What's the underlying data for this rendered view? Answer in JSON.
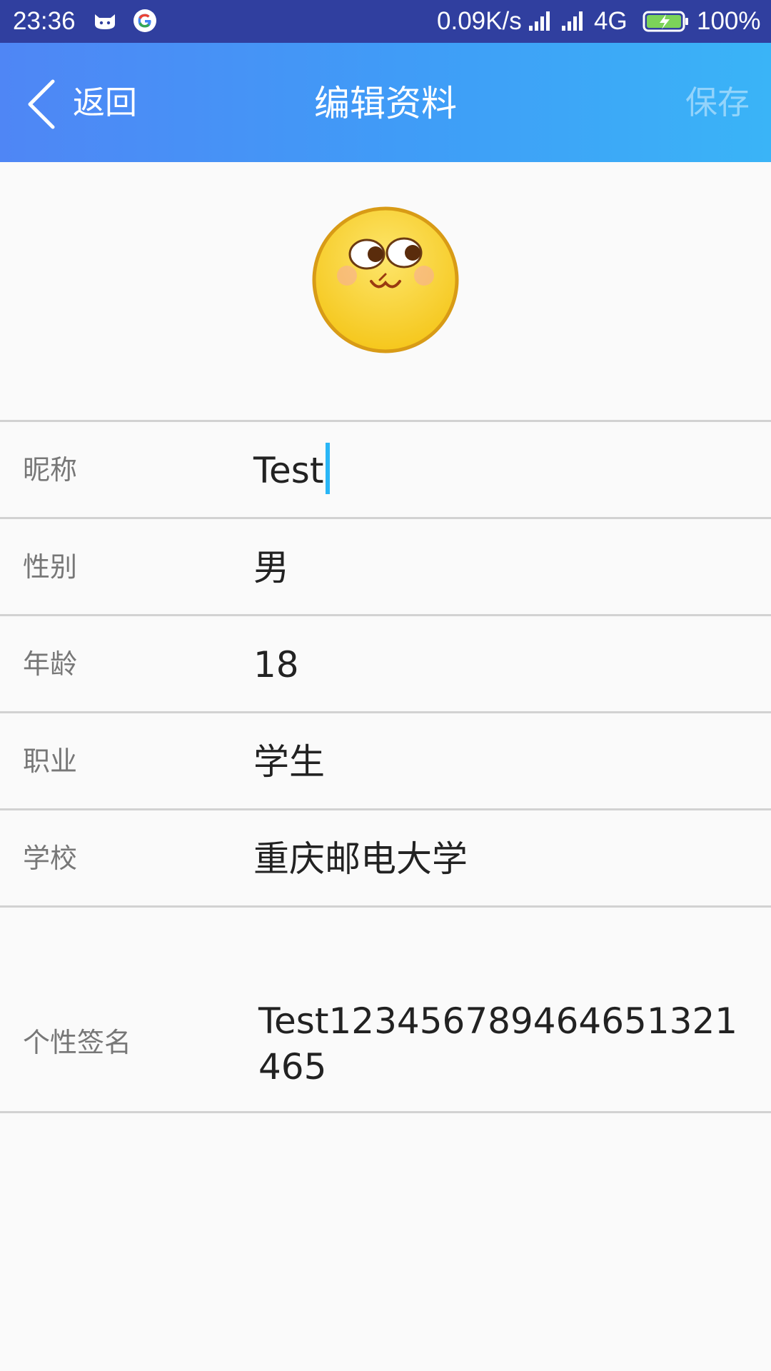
{
  "status_bar": {
    "time": "23:36",
    "net_speed": "0.09K/s",
    "network_type": "4G",
    "battery": "100%",
    "icons": [
      "cat-icon",
      "google-icon",
      "signal-icon",
      "signal-icon",
      "battery-charging-icon"
    ]
  },
  "header": {
    "back_label": "返回",
    "title": "编辑资料",
    "save_label": "保存",
    "colors": {
      "gradient_start": "#4f86f5",
      "gradient_end": "#3ab4f7"
    }
  },
  "avatar": {
    "icon": "emoji-face-icon"
  },
  "form": {
    "nickname": {
      "label": "昵称",
      "value": "Test"
    },
    "gender": {
      "label": "性别",
      "value": "男"
    },
    "age": {
      "label": "年龄",
      "value": "18"
    },
    "occupation": {
      "label": "职业",
      "value": "学生"
    },
    "school": {
      "label": "学校",
      "value": "重庆邮电大学"
    },
    "signature": {
      "label": "个性签名",
      "value": "Test123456789464651321465"
    }
  },
  "accent_color": "#29b6f6"
}
